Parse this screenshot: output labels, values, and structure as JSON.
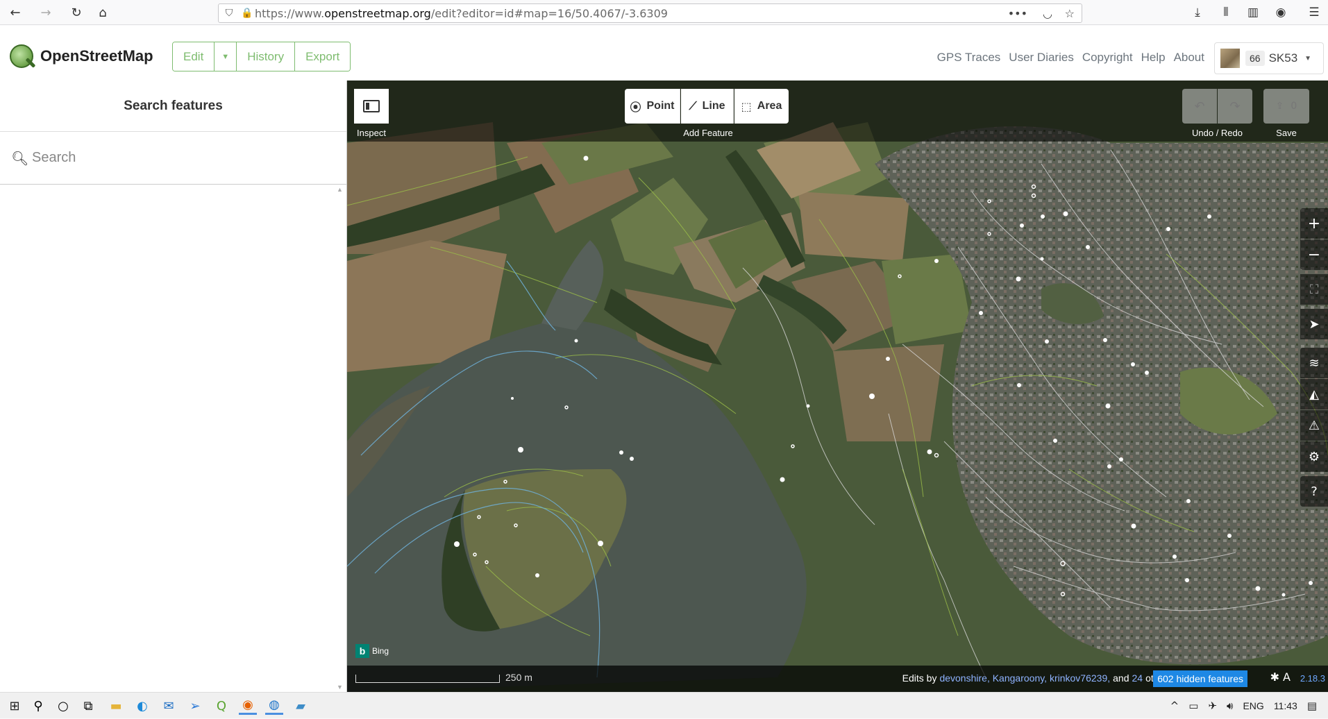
{
  "browser": {
    "url_prefix": "https://www.",
    "url_host": "openstreetmap.org",
    "url_rest": "/edit?editor=id#map=16/50.4067/-3.6309",
    "more_icon": "more-dots-icon",
    "pocket_icon": "pocket-icon",
    "star_icon": "bookmark-star-icon"
  },
  "header": {
    "logo_text": "OpenStreetMap",
    "edit_label": "Edit",
    "history_label": "History",
    "export_label": "Export",
    "nav": [
      "GPS Traces",
      "User Diaries",
      "Copyright",
      "Help",
      "About"
    ],
    "user": {
      "count": "66",
      "name": "SK53"
    }
  },
  "sidebar": {
    "title": "Search features",
    "search_placeholder": "Search"
  },
  "map": {
    "toolbar": {
      "inspect_label": "Inspect",
      "point_label": "Point",
      "line_label": "Line",
      "area_label": "Area",
      "add_feature_label": "Add Feature",
      "undo_redo_label": "Undo / Redo",
      "save_label": "Save",
      "save_count": "0"
    },
    "scale_label": "250 m",
    "bing_label": "Bing",
    "attribution": {
      "prefix": "Edits by",
      "users": "devonshire, Kangaroony, krinkov76239,",
      "and": "and",
      "others_count": "24",
      "others_label": "others"
    },
    "hidden_features": "602 hidden features",
    "version": "2.18.3",
    "colors": {
      "water": "#4d5750",
      "field": "#8c7658",
      "grass": "#6b7a4a",
      "forest": "#2f3f25",
      "urban": "#6a6a62",
      "accent": "#7ebc6f"
    }
  },
  "taskbar": {
    "lang": "ENG",
    "time": "11:43"
  }
}
